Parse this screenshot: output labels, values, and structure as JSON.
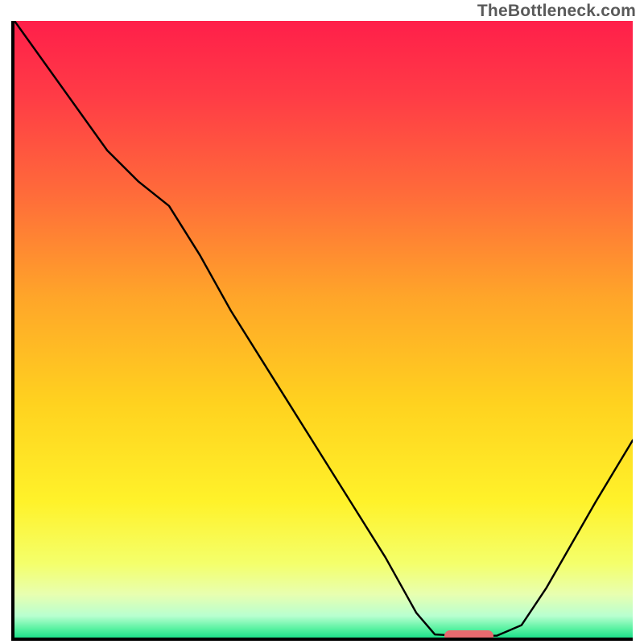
{
  "watermark": "TheBottleneck.com",
  "chart_data": {
    "type": "line",
    "title": "",
    "xlabel": "",
    "ylabel": "",
    "xlim": [
      0,
      1
    ],
    "ylim": [
      0,
      1
    ],
    "x": [
      0.0,
      0.05,
      0.1,
      0.15,
      0.2,
      0.25,
      0.3,
      0.35,
      0.4,
      0.45,
      0.5,
      0.55,
      0.6,
      0.65,
      0.68,
      0.72,
      0.78,
      0.82,
      0.86,
      0.9,
      0.94,
      1.0
    ],
    "values": [
      1.0,
      0.93,
      0.86,
      0.79,
      0.74,
      0.7,
      0.62,
      0.53,
      0.45,
      0.37,
      0.29,
      0.21,
      0.13,
      0.04,
      0.005,
      0.003,
      0.003,
      0.02,
      0.08,
      0.15,
      0.22,
      0.32
    ],
    "gradient_stops": [
      {
        "offset": 0.0,
        "color": "#ff1f4a"
      },
      {
        "offset": 0.12,
        "color": "#ff3b46"
      },
      {
        "offset": 0.28,
        "color": "#ff6b3a"
      },
      {
        "offset": 0.45,
        "color": "#ffa629"
      },
      {
        "offset": 0.62,
        "color": "#ffd21f"
      },
      {
        "offset": 0.78,
        "color": "#fff22a"
      },
      {
        "offset": 0.88,
        "color": "#f4ff6b"
      },
      {
        "offset": 0.93,
        "color": "#e8ffb0"
      },
      {
        "offset": 0.965,
        "color": "#b8ffd0"
      },
      {
        "offset": 0.985,
        "color": "#5cf2a3"
      },
      {
        "offset": 1.0,
        "color": "#1ee08a"
      }
    ],
    "marker": {
      "x0": 0.695,
      "x1": 0.775,
      "y": 0.003,
      "thickness_norm": 0.018,
      "color": "#e86a6f"
    }
  }
}
